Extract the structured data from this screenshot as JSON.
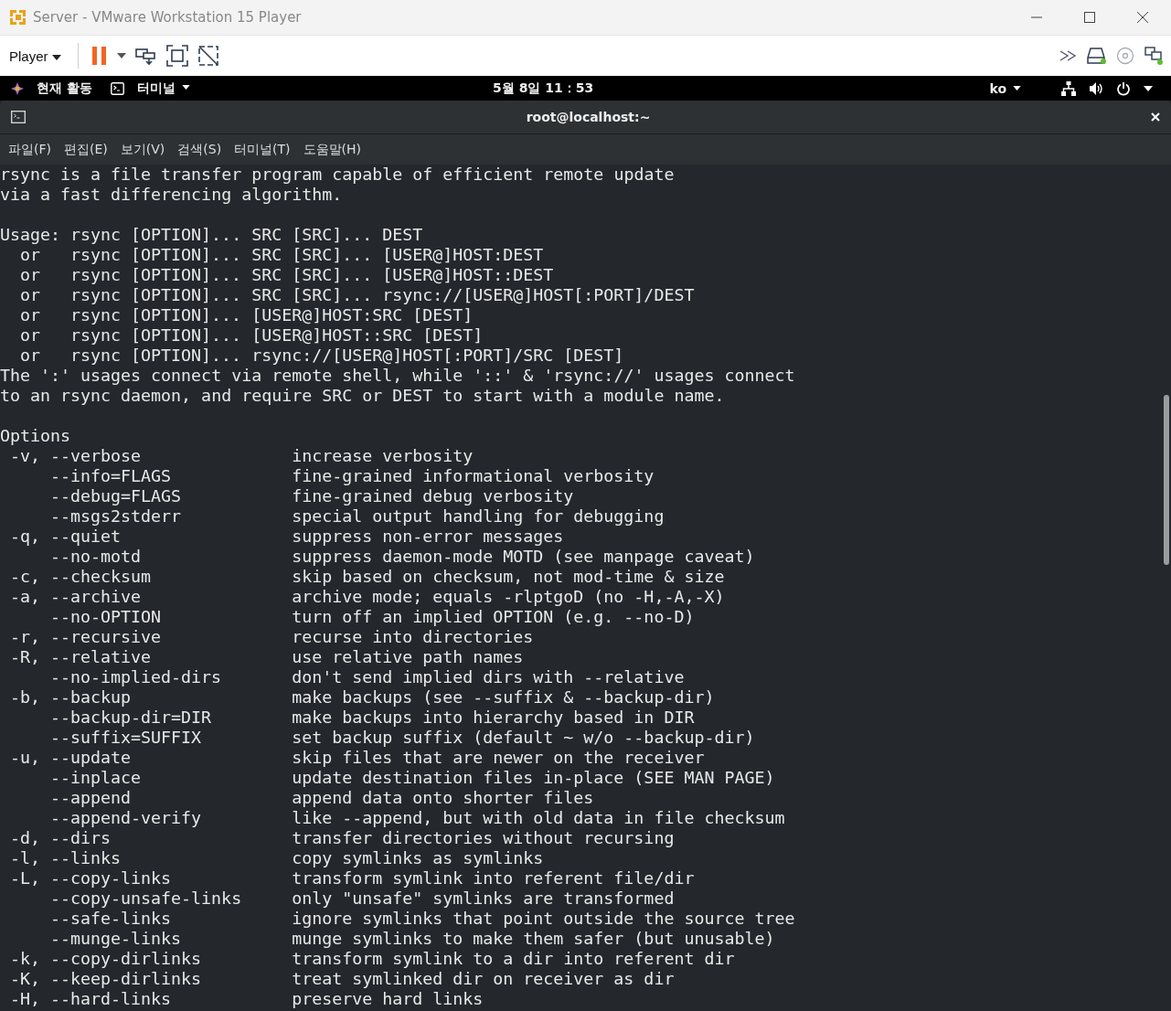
{
  "window": {
    "title": "Server - VMware Workstation 15 Player"
  },
  "toolbar": {
    "player_menu": "Player"
  },
  "top_bar": {
    "activities": "현재 활동",
    "app_menu": "터미널",
    "clock": "5월 8일  11：53",
    "input_method": "ko"
  },
  "terminal": {
    "title": "root@localhost:~",
    "menu": [
      "파일(F)",
      "편집(E)",
      "보기(V)",
      "검색(S)",
      "터미널(T)",
      "도움말(H)"
    ],
    "intro": [
      "rsync is a file transfer program capable of efficient remote update",
      "via a fast differencing algorithm."
    ],
    "usage": [
      {
        "kind": "first",
        "label": "Usage:",
        "command": "rsync [OPTION]... SRC [SRC]... DEST"
      },
      {
        "kind": "alt",
        "label": "or",
        "command": "rsync [OPTION]... SRC [SRC]... [USER@]HOST:DEST"
      },
      {
        "kind": "alt",
        "label": "or",
        "command": "rsync [OPTION]... SRC [SRC]... [USER@]HOST::DEST"
      },
      {
        "kind": "alt",
        "label": "or",
        "command": "rsync [OPTION]... SRC [SRC]... rsync://[USER@]HOST[:PORT]/DEST"
      },
      {
        "kind": "alt",
        "label": "or",
        "command": "rsync [OPTION]... [USER@]HOST:SRC [DEST]"
      },
      {
        "kind": "alt",
        "label": "or",
        "command": "rsync [OPTION]... [USER@]HOST::SRC [DEST]"
      },
      {
        "kind": "alt",
        "label": "or",
        "command": "rsync [OPTION]... rsync://[USER@]HOST[:PORT]/SRC [DEST]"
      }
    ],
    "notes": [
      "The ':' usages connect via remote shell, while '::' & 'rsync://' usages connect",
      "to an rsync daemon, and require SRC or DEST to start with a module name."
    ],
    "options_heading": "Options",
    "options": [
      {
        "short": "-v,",
        "long": "--verbose",
        "description": "increase verbosity"
      },
      {
        "long": "--info=FLAGS",
        "description": "fine-grained informational verbosity"
      },
      {
        "long": "--debug=FLAGS",
        "description": "fine-grained debug verbosity"
      },
      {
        "long": "--msgs2stderr",
        "description": "special output handling for debugging"
      },
      {
        "short": "-q,",
        "long": "--quiet",
        "description": "suppress non-error messages"
      },
      {
        "long": "--no-motd",
        "description": "suppress daemon-mode MOTD (see manpage caveat)"
      },
      {
        "short": "-c,",
        "long": "--checksum",
        "description": "skip based on checksum, not mod-time & size"
      },
      {
        "short": "-a,",
        "long": "--archive",
        "description": "archive mode; equals -rlptgoD (no -H,-A,-X)"
      },
      {
        "long": "--no-OPTION",
        "description": "turn off an implied OPTION (e.g. --no-D)"
      },
      {
        "short": "-r,",
        "long": "--recursive",
        "description": "recurse into directories"
      },
      {
        "short": "-R,",
        "long": "--relative",
        "description": "use relative path names"
      },
      {
        "long": "--no-implied-dirs",
        "description": "don't send implied dirs with --relative"
      },
      {
        "short": "-b,",
        "long": "--backup",
        "description": "make backups (see --suffix & --backup-dir)"
      },
      {
        "long": "--backup-dir=DIR",
        "description": "make backups into hierarchy based in DIR"
      },
      {
        "long": "--suffix=SUFFIX",
        "description": "set backup suffix (default ~ w/o --backup-dir)"
      },
      {
        "short": "-u,",
        "long": "--update",
        "description": "skip files that are newer on the receiver"
      },
      {
        "long": "--inplace",
        "description": "update destination files in-place (SEE MAN PAGE)"
      },
      {
        "long": "--append",
        "description": "append data onto shorter files"
      },
      {
        "long": "--append-verify",
        "description": "like --append, but with old data in file checksum"
      },
      {
        "short": "-d,",
        "long": "--dirs",
        "description": "transfer directories without recursing"
      },
      {
        "short": "-l,",
        "long": "--links",
        "description": "copy symlinks as symlinks"
      },
      {
        "short": "-L,",
        "long": "--copy-links",
        "description": "transform symlink into referent file/dir"
      },
      {
        "long": "--copy-unsafe-links",
        "description": "only \"unsafe\" symlinks are transformed"
      },
      {
        "long": "--safe-links",
        "description": "ignore symlinks that point outside the source tree"
      },
      {
        "long": "--munge-links",
        "description": "munge symlinks to make them safer (but unusable)"
      },
      {
        "short": "-k,",
        "long": "--copy-dirlinks",
        "description": "transform symlink to a dir into referent dir"
      },
      {
        "short": "-K,",
        "long": "--keep-dirlinks",
        "description": "treat symlinked dir on receiver as dir"
      },
      {
        "short": "-H,",
        "long": "--hard-links",
        "description": "preserve hard links"
      }
    ]
  }
}
